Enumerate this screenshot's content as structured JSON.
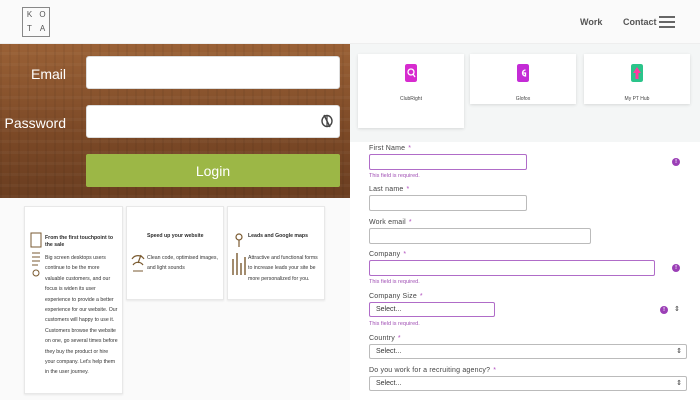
{
  "nav": {
    "logo_letters": [
      "K",
      "O",
      "T",
      "A"
    ],
    "links": [
      "Work",
      "Contact"
    ],
    "menu_icon": "hamburger-icon"
  },
  "login": {
    "email_label": "Email",
    "password_label": "Password",
    "email_value": "",
    "password_value": "",
    "password_toggle_icon": "eye-slash-icon",
    "login_button": "Login",
    "button_color": "#9cb746"
  },
  "features": [
    {
      "icon": "customer-journey-icon",
      "title": "From the first touchpoint to the sale",
      "body": "Big screen desktops users continue to be the more valuable customers, and our focus is widen its user experience to provide a better experience for our website. Our customers will happy to use it. Customers browse the website on one, go several times before they buy the product or hire your company. Let's help them in the user journey."
    },
    {
      "icon": "speed-icon",
      "title": "Speed up your website",
      "body": "Clean code, optimised images, and light sounds"
    },
    {
      "icon": "leads-map-icon",
      "title": "Leads and Google maps",
      "body": "Attractive and functional forms to increase leads your site be more personalized for you."
    }
  ],
  "integrations": [
    {
      "name": "ClubRight",
      "icon": "clubright-icon",
      "color": "#d72bcf"
    },
    {
      "name": "Glofox",
      "icon": "glofox-icon",
      "color": "#c42bd6"
    },
    {
      "name": "My PT Hub",
      "icon": "myptHub-icon",
      "color": "#2bc48a"
    }
  ],
  "form": {
    "required_marker": "*",
    "first_name": {
      "label": "First Name",
      "value": "",
      "error": "This field is required."
    },
    "last_name": {
      "label": "Last name",
      "value": ""
    },
    "work_email": {
      "label": "Work email",
      "value": ""
    },
    "company": {
      "label": "Company",
      "value": "",
      "error": "This field is required."
    },
    "company_size": {
      "label": "Company Size",
      "selected": "Select...",
      "error": "This field is required."
    },
    "country": {
      "label": "Country",
      "selected": "Select..."
    },
    "recruiting": {
      "label": "Do you work for a recruiting agency?",
      "selected": "Select..."
    },
    "error_badge": "!",
    "error_color": "#9b3fb6"
  }
}
